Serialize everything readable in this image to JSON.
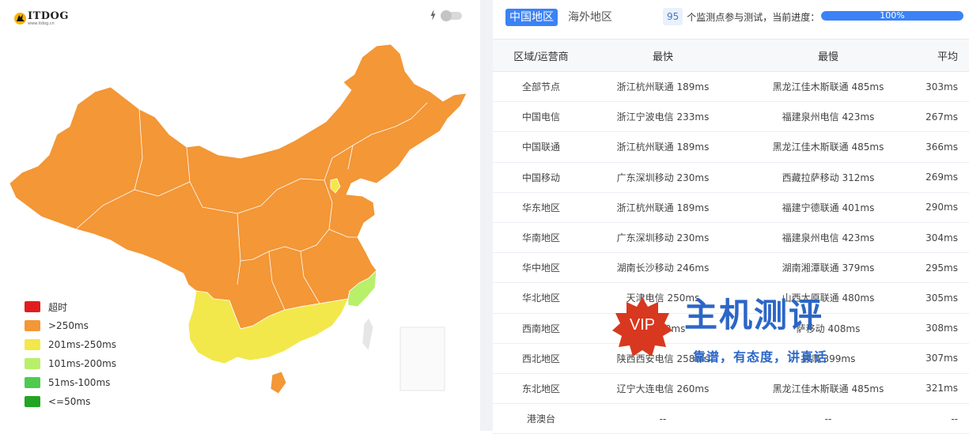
{
  "logo": {
    "name": "ITDOG",
    "url": "www.itdog.cn"
  },
  "colors": {
    "timeout": "#e11d1d",
    "over250": "#f39737",
    "r201_250": "#f2e84b",
    "r101_200": "#b8f06a",
    "r51_100": "#4ecb4e",
    "le50": "#22a522",
    "accent": "#3b82f6"
  },
  "legend": [
    {
      "label": "超时",
      "color": "#e11d1d"
    },
    {
      "label": ">250ms",
      "color": "#f39737"
    },
    {
      "label": "201ms-250ms",
      "color": "#f2e84b"
    },
    {
      "label": "101ms-200ms",
      "color": "#b8f06a"
    },
    {
      "label": "51ms-100ms",
      "color": "#4ecb4e"
    },
    {
      "label": "<=50ms",
      "color": "#22a522"
    }
  ],
  "tabs": {
    "china": "中国地区",
    "overseas": "海外地区"
  },
  "probe": {
    "count": "95",
    "text": "个监测点参与测试，当前进度：",
    "progress_label": "100%",
    "progress": 1.0
  },
  "table": {
    "headers": {
      "region": "区域/运营商",
      "fastest": "最快",
      "slowest": "最慢",
      "avg": "平均"
    },
    "rows": [
      {
        "region": "全部节点",
        "fastest": "浙江杭州联通 189ms",
        "slowest": "黑龙江佳木斯联通 485ms",
        "avg": "303ms"
      },
      {
        "region": "中国电信",
        "fastest": "浙江宁波电信 233ms",
        "slowest": "福建泉州电信 423ms",
        "avg": "267ms"
      },
      {
        "region": "中国联通",
        "fastest": "浙江杭州联通 189ms",
        "slowest": "黑龙江佳木斯联通 485ms",
        "avg": "366ms"
      },
      {
        "region": "中国移动",
        "fastest": "广东深圳移动 230ms",
        "slowest": "西藏拉萨移动 312ms",
        "avg": "269ms"
      },
      {
        "region": "华东地区",
        "fastest": "浙江杭州联通 189ms",
        "slowest": "福建宁德联通 401ms",
        "avg": "290ms"
      },
      {
        "region": "华南地区",
        "fastest": "广东深圳移动 230ms",
        "slowest": "福建泉州电信 423ms",
        "avg": "304ms"
      },
      {
        "region": "华中地区",
        "fastest": "湖南长沙移动 246ms",
        "slowest": "湖南湘潭联通 379ms",
        "avg": "295ms"
      },
      {
        "region": "华北地区",
        "fastest": "天津电信 250ms",
        "slowest": "山西太原联通 480ms",
        "avg": "305ms"
      },
      {
        "region": "西南地区",
        "fastest": "信 240ms",
        "slowest": "萨移动 408ms",
        "avg": "308ms"
      },
      {
        "region": "西北地区",
        "fastest": "陕西西安电信 258ms",
        "slowest": "甘肃 399ms",
        "avg": "307ms"
      },
      {
        "region": "东北地区",
        "fastest": "辽宁大连电信 260ms",
        "slowest": "黑龙江佳木斯联通 485ms",
        "avg": "321ms"
      },
      {
        "region": "港澳台",
        "fastest": "--",
        "slowest": "--",
        "avg": "--"
      }
    ]
  },
  "watermark": {
    "badge": "VIP",
    "title": "主机测评",
    "subtitle": "靠谱，有态度，讲真话"
  }
}
